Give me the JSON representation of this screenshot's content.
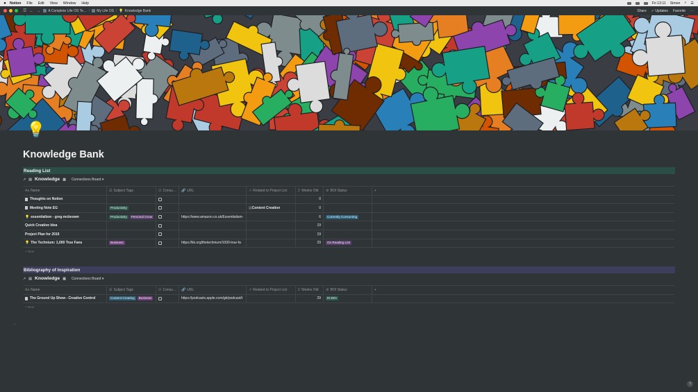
{
  "menubar": {
    "app_name": "Notion",
    "items": [
      "File",
      "Edit",
      "View",
      "Window",
      "Help"
    ],
    "clock": "Fri 13:11",
    "user": "Simon"
  },
  "titlebar": {
    "breadcrumbs": [
      "A Complete Life OS Te…",
      "My Life OS",
      "Knowledge Bank"
    ],
    "actions": [
      "Share",
      "✓ Updates",
      "Favorite",
      "···"
    ]
  },
  "page": {
    "icon": "💡",
    "title": "Knowledge Bank"
  },
  "sections": [
    {
      "heading": "Reading List",
      "heading_color": "#2b4e46",
      "db_title": "Knowledge",
      "view": "Connections Board ▾",
      "columns": [
        "Name",
        "Subject Tags",
        "Consu…",
        "URL",
        "Related to Project List",
        "Weeks Old",
        "BOI Status",
        "+"
      ],
      "rows": [
        {
          "icon": "doc",
          "name": "Thoughts on Notion",
          "tags": [],
          "url": "",
          "related": "",
          "weeks": "0",
          "status": []
        },
        {
          "icon": "doc",
          "name": "Meeting Note EG",
          "tags": [
            {
              "label": "Productivity",
              "color": "#2e5a4e"
            }
          ],
          "url": "",
          "related": "Content Creation",
          "weeks": "0",
          "status": []
        },
        {
          "icon": "bulb",
          "name": "essentialism - greg mckeown",
          "tags": [
            {
              "label": "Productivity",
              "color": "#2e5a4e"
            },
            {
              "label": "Personal Grow",
              "color": "#5b3f6e"
            }
          ],
          "url": "https://www.amazon.co.uk/Essentialism-",
          "related": "",
          "weeks": "6",
          "status": [
            {
              "label": "Currently Consuming",
              "color": "#2b5f7a"
            }
          ]
        },
        {
          "icon": "",
          "name": "Quick Creative Idea",
          "tags": [],
          "url": "",
          "related": "",
          "weeks": "19",
          "status": []
        },
        {
          "icon": "",
          "name": "Project Plan for 2019",
          "tags": [],
          "url": "",
          "related": "",
          "weeks": "19",
          "status": []
        },
        {
          "icon": "bulb",
          "name": "The Technium: 1,000 True Fans",
          "tags": [
            {
              "label": "Business",
              "color": "#6d3f7a"
            }
          ],
          "url": "https://kk.org/thetechnium/1000-true-fa",
          "related": "",
          "weeks": "29",
          "status": [
            {
              "label": "On Reading List",
              "color": "#5e3f73"
            }
          ]
        }
      ],
      "new_label": "+ New"
    },
    {
      "heading": "Bibliography of Inspiration",
      "heading_color": "#3d3d5c",
      "db_title": "Knowledge",
      "view": "Connections Board ▾",
      "columns": [
        "Name",
        "Subject Tags",
        "Consu…",
        "URL",
        "Related to Project List",
        "Weeks Old",
        "BOI Status",
        "+"
      ],
      "rows": [
        {
          "icon": "doc",
          "name": "The Ground Up Show - Creative Control",
          "tags": [
            {
              "label": "Content Creating",
              "color": "#2b5f7a"
            },
            {
              "label": "Business",
              "color": "#6d3f7a"
            }
          ],
          "url": "https://podcasts.apple.com/gb/podcast/t",
          "related": "",
          "weeks": "29",
          "status": [
            {
              "label": "IN BOI",
              "color": "#2e5a4e"
            }
          ]
        }
      ],
      "new_label": "+ New"
    }
  ],
  "help_label": "?"
}
